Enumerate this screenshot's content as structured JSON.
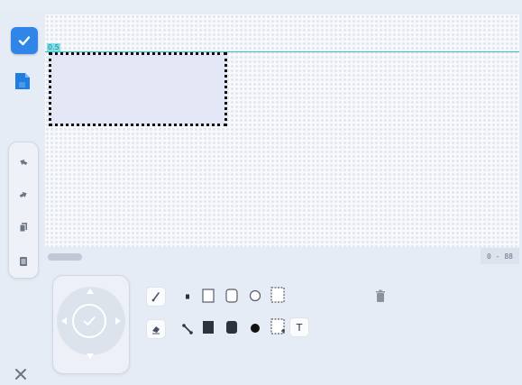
{
  "canvas": {
    "guide_label": "0.5",
    "range_readout": "0 - 88"
  },
  "toolbar": {
    "text_tool_label": "T"
  },
  "colors": {
    "accent": "#2f86e8",
    "guide": "#2fc4bf",
    "selection_fill": "#e3e6f4",
    "panel_bg": "#e6ecf5"
  },
  "icons": {
    "confirm": "checkmark-icon",
    "document": "document-icon",
    "undo": "undo-icon",
    "redo": "redo-icon",
    "copy": "copy-icon",
    "list": "list-icon",
    "close": "close-icon",
    "trash": "trash-icon"
  }
}
